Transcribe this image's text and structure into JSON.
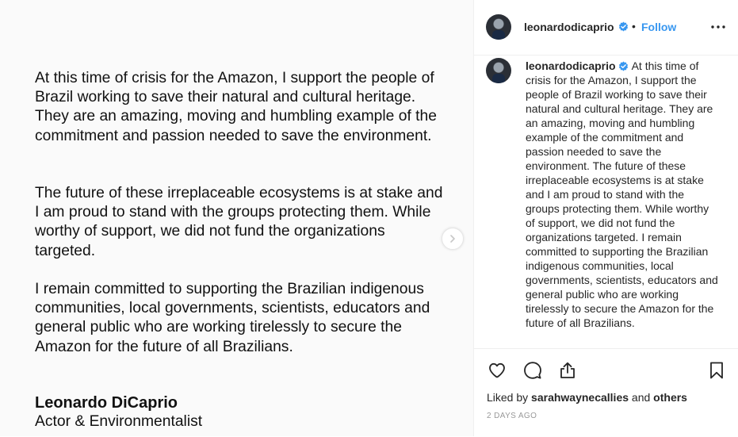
{
  "post": {
    "statement": {
      "paragraph1": "At this time of crisis for the Amazon, I support the people of Brazil working to save their natural and cultural heritage. They are an amazing, moving and humbling example of the commitment and passion needed to save the environment.",
      "paragraph2": "The future of these irreplaceable ecosystems is at stake and I am proud to stand with the groups protecting them. While worthy of support, we did not fund the organizations targeted.",
      "paragraph3": "I remain committed to supporting the Brazilian indigenous communities, local governments, scientists, educators and general public who are working tirelessly to secure the Amazon for the future of all Brazilians.",
      "signature_name": "Leonardo DiCaprio",
      "signature_title": "Actor & Environmentalist"
    },
    "carousel_next_icon": "chevron-right-icon"
  },
  "header": {
    "username": "leonardodicaprio",
    "separator": "•",
    "follow_label": "Follow",
    "more_icon": "ellipsis-icon"
  },
  "caption": {
    "username": "leonardodicaprio",
    "text": "At this time of crisis for the Amazon, I support the people of Brazil working to save their natural and cultural heritage. They are an amazing, moving and humbling example of the commitment and passion needed to save the environment. The future of these irreplaceable ecosystems is at stake and I am proud to stand with the groups protecting them. While worthy of support, we did not fund the organizations targeted. I remain committed to supporting the Brazilian indigenous communities, local governments, scientists, educators and general public who are working tirelessly to secure the Amazon for the future of all Brazilians."
  },
  "actions": {
    "like_icon": "heart-icon",
    "comment_icon": "comment-icon",
    "share_icon": "share-icon",
    "save_icon": "bookmark-icon"
  },
  "likes": {
    "prefix": "Liked by",
    "user": "sarahwaynecallies",
    "joiner": "and",
    "others": "others"
  },
  "timestamp": "2 DAYS AGO",
  "colors": {
    "link_blue": "#3897f0",
    "verified_blue": "#3897f0",
    "text": "#262626",
    "muted": "#999999"
  }
}
